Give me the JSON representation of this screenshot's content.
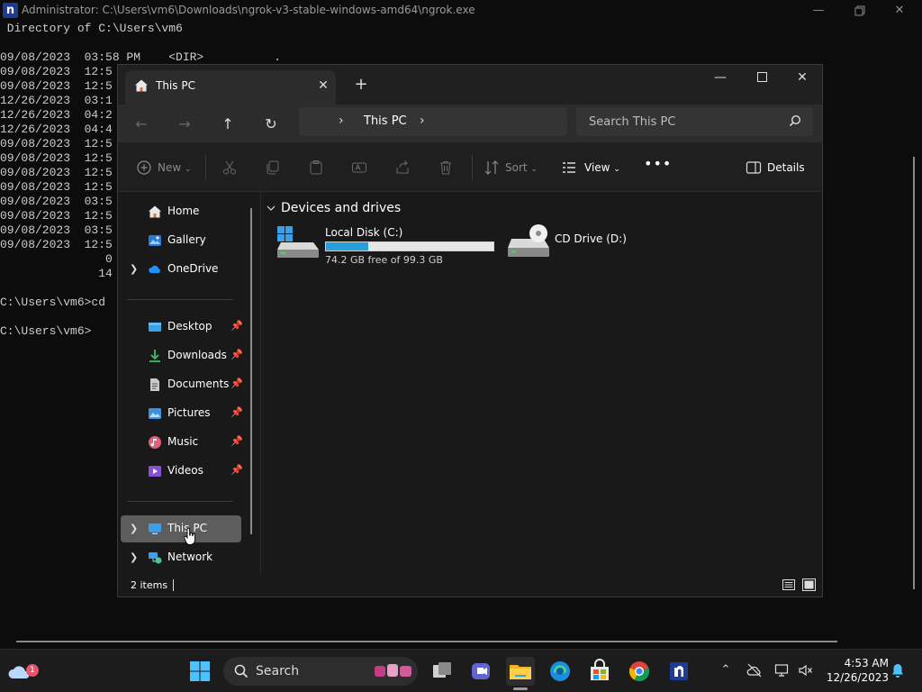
{
  "console": {
    "title": "Administrator: C:\\Users\\vm6\\Downloads\\ngrok-v3-stable-windows-amd64\\ngrok.exe",
    "lines": [
      " Directory of C:\\Users\\vm6",
      "",
      "09/08/2023  03:58 PM    <DIR>          .",
      "09/08/2023  12:5",
      "09/08/2023  12:5",
      "12/26/2023  03:1",
      "12/26/2023  04:2",
      "12/26/2023  04:4",
      "09/08/2023  12:5",
      "09/08/2023  12:5",
      "09/08/2023  12:5",
      "09/08/2023  12:5",
      "09/08/2023  03:5",
      "09/08/2023  12:5",
      "09/08/2023  03:5",
      "09/08/2023  12:5",
      "               0",
      "              14",
      "",
      "C:\\Users\\vm6>cd",
      "",
      "C:\\Users\\vm6>"
    ]
  },
  "explorer": {
    "tab_title": "This PC",
    "address": {
      "crumb": "This PC"
    },
    "search": {
      "placeholder": "Search This PC"
    },
    "commands": {
      "new": "New",
      "sort": "Sort",
      "view": "View",
      "details": "Details"
    },
    "nav": {
      "home": "Home",
      "gallery": "Gallery",
      "onedrive": "OneDrive",
      "desktop": "Desktop",
      "downloads": "Downloads",
      "documents": "Documents",
      "pictures": "Pictures",
      "music": "Music",
      "videos": "Videos",
      "thispc": "This PC",
      "network": "Network"
    },
    "group_header": "Devices and drives",
    "drives": [
      {
        "name": "Local Disk (C:)",
        "free_text": "74.2 GB free of 99.3 GB",
        "used_fraction": 0.253
      },
      {
        "name": "CD Drive (D:)"
      }
    ],
    "status": {
      "items": "2 items"
    }
  },
  "taskbar": {
    "search_label": "Search",
    "weather_badge": "1",
    "time": "4:53 AM",
    "date": "12/26/2023"
  },
  "colors": {
    "accent": "#0078d4",
    "drive_bar": "#26a0da",
    "selection": "#5d5d5d"
  }
}
